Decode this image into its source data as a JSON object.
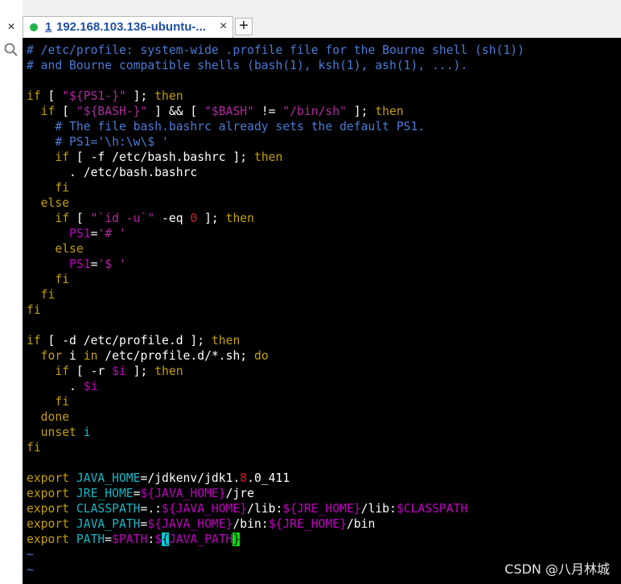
{
  "left_strip": {
    "close_glyph": "×",
    "search_icon": "search-icon"
  },
  "tab": {
    "number": "1",
    "title": "192.168.103.136-ubuntu-...",
    "close_glyph": "×",
    "status_color": "#22b14c"
  },
  "new_tab_glyph": "+",
  "terminal": {
    "lines": [
      [
        [
          "# /etc/profile: system-wide .profile file for the Bourne shell (sh(1))",
          "cmt"
        ]
      ],
      [
        [
          "# and Bourne compatible shells (bash(1), ksh(1), ash(1), ...).",
          "cmt"
        ]
      ],
      [],
      [
        [
          "if",
          "kw"
        ],
        [
          " [ ",
          ""
        ],
        [
          "\"${PS1-}\"",
          "str"
        ],
        [
          " ]; ",
          ""
        ],
        [
          "then",
          "kw"
        ]
      ],
      [
        [
          "  if",
          "kw"
        ],
        [
          " [ ",
          ""
        ],
        [
          "\"${BASH-}\"",
          "str"
        ],
        [
          " ] && [ ",
          ""
        ],
        [
          "\"$BASH\"",
          "str"
        ],
        [
          " != ",
          ""
        ],
        [
          "\"/bin/sh\"",
          "str"
        ],
        [
          " ]; ",
          ""
        ],
        [
          "then",
          "kw"
        ]
      ],
      [
        [
          "    # The file bash.bashrc already sets the default PS1.",
          "cmt"
        ]
      ],
      [
        [
          "    # PS1='\\h:\\w\\$ '",
          "cmt"
        ]
      ],
      [
        [
          "    if",
          "kw"
        ],
        [
          " [ -f /etc/bash.bashrc ]; ",
          ""
        ],
        [
          "then",
          "kw"
        ]
      ],
      [
        [
          "      . /etc/bash.bashrc",
          ""
        ]
      ],
      [
        [
          "    fi",
          "kw"
        ]
      ],
      [
        [
          "  else",
          "kw"
        ]
      ],
      [
        [
          "    if",
          "kw"
        ],
        [
          " [ ",
          ""
        ],
        [
          "\"`id -u`\"",
          "str"
        ],
        [
          " -eq ",
          ""
        ],
        [
          "0",
          "num"
        ],
        [
          " ]; ",
          ""
        ],
        [
          "then",
          "kw"
        ]
      ],
      [
        [
          "      PS1",
          "var"
        ],
        [
          "=",
          ""
        ],
        [
          "'# '",
          "str"
        ]
      ],
      [
        [
          "    else",
          "kw"
        ]
      ],
      [
        [
          "      PS1",
          "var"
        ],
        [
          "=",
          ""
        ],
        [
          "'$ '",
          "str"
        ]
      ],
      [
        [
          "    fi",
          "kw"
        ]
      ],
      [
        [
          "  fi",
          "kw"
        ]
      ],
      [
        [
          "fi",
          "kw"
        ]
      ],
      [],
      [
        [
          "if",
          "kw"
        ],
        [
          " [ -d /etc/profile.d ]; ",
          ""
        ],
        [
          "then",
          "kw"
        ]
      ],
      [
        [
          "  for",
          "kw"
        ],
        [
          " i ",
          ""
        ],
        [
          "in",
          "kw"
        ],
        [
          " /etc/profile.d/*.sh; ",
          ""
        ],
        [
          "do",
          "kw"
        ]
      ],
      [
        [
          "    if",
          "kw"
        ],
        [
          " [ -r ",
          ""
        ],
        [
          "$i",
          "var"
        ],
        [
          " ]; ",
          ""
        ],
        [
          "then",
          "kw"
        ]
      ],
      [
        [
          "      . ",
          ""
        ],
        [
          "$i",
          "var"
        ]
      ],
      [
        [
          "    fi",
          "kw"
        ]
      ],
      [
        [
          "  done",
          "kw"
        ]
      ],
      [
        [
          "  unset",
          "kw"
        ],
        [
          " ",
          ""
        ],
        [
          "i",
          "cy"
        ]
      ],
      [
        [
          "fi",
          "kw"
        ]
      ],
      [],
      [
        [
          "export",
          "kw"
        ],
        [
          " ",
          ""
        ],
        [
          "JAVA_HOME",
          "cy"
        ],
        [
          "=/jdkenv/jdk1.",
          ""
        ],
        [
          "8",
          "num"
        ],
        [
          ".0_411",
          ""
        ]
      ],
      [
        [
          "export",
          "kw"
        ],
        [
          " ",
          ""
        ],
        [
          "JRE_HOME",
          "cy"
        ],
        [
          "=",
          ""
        ],
        [
          "${JAVA_HOME}",
          "var"
        ],
        [
          "/jre",
          ""
        ]
      ],
      [
        [
          "export",
          "kw"
        ],
        [
          " ",
          ""
        ],
        [
          "CLASSPATH",
          "cy"
        ],
        [
          "=.:",
          ""
        ],
        [
          "${JAVA_HOME}",
          "var"
        ],
        [
          "/lib:",
          ""
        ],
        [
          "${JRE_HOME}",
          "var"
        ],
        [
          "/lib:",
          ""
        ],
        [
          "$CLASSPATH",
          "var"
        ]
      ],
      [
        [
          "export",
          "kw"
        ],
        [
          " ",
          ""
        ],
        [
          "JAVA_PATH",
          "cy"
        ],
        [
          "=",
          ""
        ],
        [
          "${JAVA_HOME}",
          "var"
        ],
        [
          "/bin:",
          ""
        ],
        [
          "${JRE_HOME}",
          "var"
        ],
        [
          "/bin",
          ""
        ]
      ],
      [
        [
          "export",
          "kw"
        ],
        [
          " ",
          ""
        ],
        [
          "PATH",
          "cy"
        ],
        [
          "=",
          ""
        ],
        [
          "$PATH",
          "var"
        ],
        [
          ":",
          ""
        ],
        [
          "$",
          "var"
        ],
        [
          "{",
          "cursor-l"
        ],
        [
          "JAVA_PATH",
          "var"
        ],
        [
          "}",
          "cursor-r"
        ]
      ],
      [
        [
          "~",
          "tilde"
        ]
      ],
      [
        [
          "~",
          "tilde"
        ]
      ]
    ]
  },
  "watermark": "CSDN @八月林城"
}
